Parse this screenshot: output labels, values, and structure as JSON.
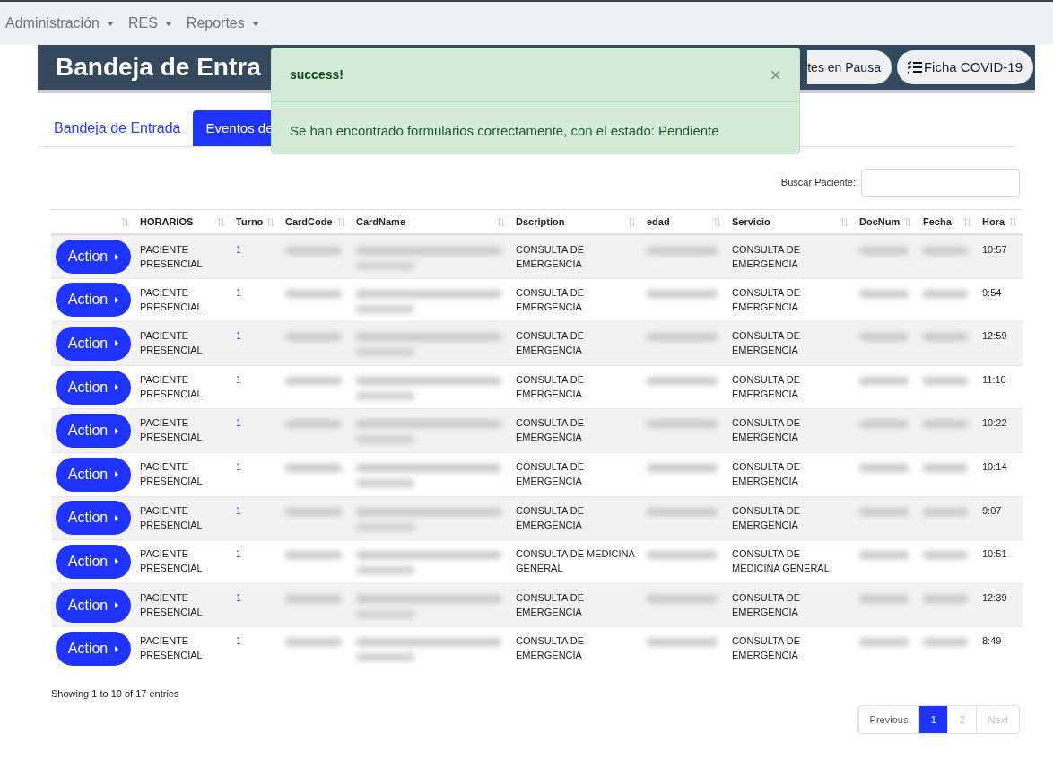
{
  "navbar": {
    "menus": [
      {
        "label": "Administración"
      },
      {
        "label": "RES"
      },
      {
        "label": "Reportes"
      }
    ]
  },
  "header": {
    "title": "Bandeja de Entra",
    "buttons": [
      {
        "label": "tes en Pausa",
        "kind": "plain"
      },
      {
        "label": "Ficha COVID-19",
        "kind": "checklist"
      }
    ]
  },
  "tabs": [
    {
      "label": "Bandeja de Entrada",
      "selected": false
    },
    {
      "label": "Eventos de",
      "selected": true
    }
  ],
  "alert": {
    "title": "success!",
    "close": "×",
    "message": "Se han encontrado formularios correctamente, con el estado: Pendiente"
  },
  "search": {
    "label": "Buscar Páciente:"
  },
  "table": {
    "columns": [
      {
        "kind": "action"
      },
      {
        "label": "HORARIOS",
        "kind": "horario"
      },
      {
        "label": "Turno",
        "kind": "turno"
      },
      {
        "label": "CardCode",
        "kind": "redacted"
      },
      {
        "label": "CardName",
        "kind": "redacted2"
      },
      {
        "label": "Dscription",
        "kind": "description"
      },
      {
        "label": "edad",
        "kind": "redacted"
      },
      {
        "label": "Servicio",
        "kind": "servicio"
      },
      {
        "label": "DocNum",
        "kind": "redacted"
      },
      {
        "label": "Fecha",
        "kind": "redacted"
      },
      {
        "label": "Hora",
        "kind": "hora"
      }
    ],
    "rows": [
      {
        "action": "Action",
        "horario": "PACIENTE PRESENCIAL",
        "turno": "1",
        "description": "CONSULTA DE EMERGENCIA",
        "servicio": "CONSULTA DE EMERGENCIA",
        "hora": "10:57"
      },
      {
        "action": "Action",
        "horario": "PACIENTE PRESENCIAL",
        "turno": "1",
        "description": "CONSULTA DE EMERGENCIA",
        "servicio": "CONSULTA DE EMERGENCIA",
        "hora": "9:54"
      },
      {
        "action": "Action",
        "horario": "PACIENTE PRESENCIAL",
        "turno": "1",
        "description": "CONSULTA DE EMERGENCIA",
        "servicio": "CONSULTA DE EMERGENCIA",
        "hora": "12:59"
      },
      {
        "action": "Action",
        "horario": "PACIENTE PRESENCIAL",
        "turno": "1",
        "description": "CONSULTA DE EMERGENCIA",
        "servicio": "CONSULTA DE EMERGENCIA",
        "hora": "11:10"
      },
      {
        "action": "Action",
        "horario": "PACIENTE PRESENCIAL",
        "turno": "1",
        "description": "CONSULTA DE EMERGENCIA",
        "servicio": "CONSULTA DE EMERGENCIA",
        "hora": "10:22"
      },
      {
        "action": "Action",
        "horario": "PACIENTE PRESENCIAL",
        "turno": "1",
        "description": "CONSULTA DE EMERGENCIA",
        "servicio": "CONSULTA DE EMERGENCIA",
        "hora": "10:14"
      },
      {
        "action": "Action",
        "horario": "PACIENTE PRESENCIAL",
        "turno": "1",
        "description": "CONSULTA DE EMERGENCIA",
        "servicio": "CONSULTA DE EMERGENCIA",
        "hora": "9:07"
      },
      {
        "action": "Action",
        "horario": "PACIENTE PRESENCIAL",
        "turno": "1",
        "description": "CONSULTA DE MEDICINA GENERAL",
        "servicio": "CONSULTA DE MEDICINA GENERAL",
        "hora": "10:51"
      },
      {
        "action": "Action",
        "horario": "PACIENTE PRESENCIAL",
        "turno": "1",
        "description": "CONSULTA DE EMERGENCIA",
        "servicio": "CONSULTA DE EMERGENCIA",
        "hora": "12:39"
      },
      {
        "action": "Action",
        "horario": "PACIENTE PRESENCIAL",
        "turno": "1",
        "description": "CONSULTA DE EMERGENCIA",
        "servicio": "CONSULTA DE EMERGENCIA",
        "hora": "8:49"
      }
    ]
  },
  "footer": {
    "info": "Showing 1 to 10 of 17 entries",
    "pagination": [
      {
        "label": "Previous",
        "kind": "nav",
        "disabled": false,
        "selected": false
      },
      {
        "label": "1",
        "kind": "page",
        "disabled": false,
        "selected": true
      },
      {
        "label": "2",
        "kind": "page",
        "disabled": true,
        "selected": false
      },
      {
        "label": "Next",
        "kind": "nav",
        "disabled": true,
        "selected": false
      }
    ]
  }
}
